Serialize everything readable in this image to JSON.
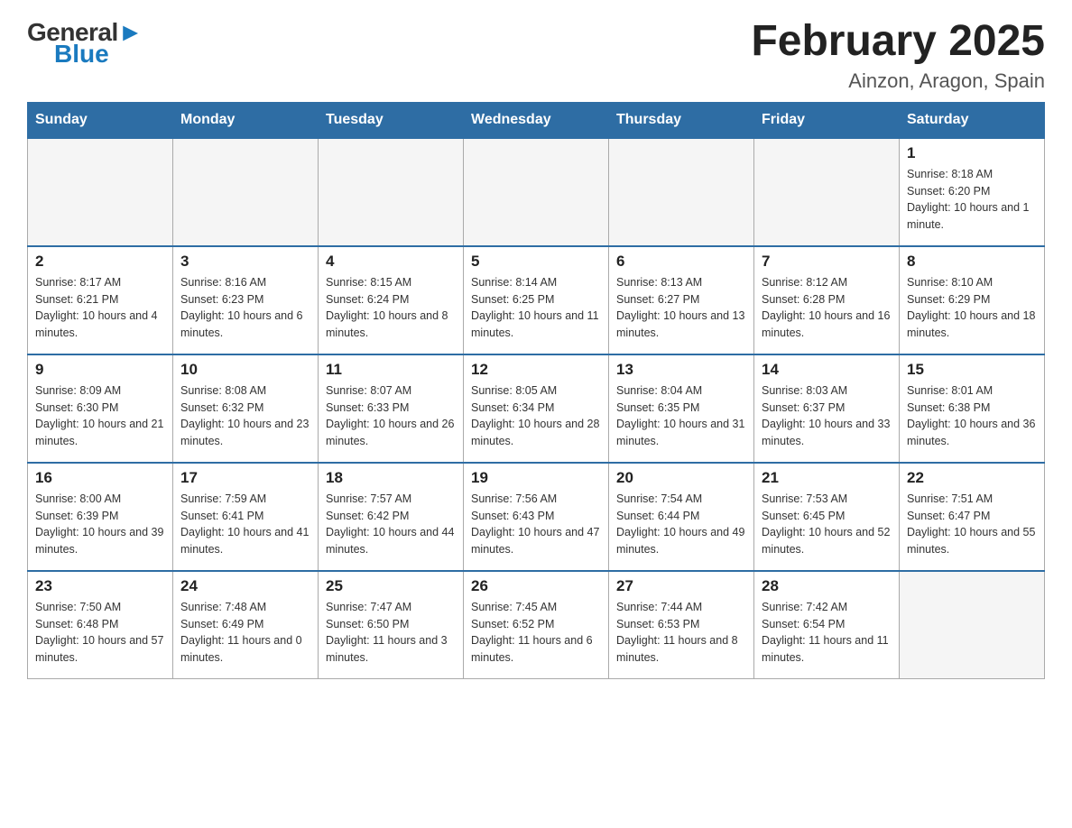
{
  "header": {
    "logo_general": "General",
    "logo_blue": "Blue",
    "title": "February 2025",
    "subtitle": "Ainzon, Aragon, Spain"
  },
  "days_of_week": [
    "Sunday",
    "Monday",
    "Tuesday",
    "Wednesday",
    "Thursday",
    "Friday",
    "Saturday"
  ],
  "weeks": [
    [
      {
        "day": "",
        "info": ""
      },
      {
        "day": "",
        "info": ""
      },
      {
        "day": "",
        "info": ""
      },
      {
        "day": "",
        "info": ""
      },
      {
        "day": "",
        "info": ""
      },
      {
        "day": "",
        "info": ""
      },
      {
        "day": "1",
        "info": "Sunrise: 8:18 AM\nSunset: 6:20 PM\nDaylight: 10 hours and 1 minute."
      }
    ],
    [
      {
        "day": "2",
        "info": "Sunrise: 8:17 AM\nSunset: 6:21 PM\nDaylight: 10 hours and 4 minutes."
      },
      {
        "day": "3",
        "info": "Sunrise: 8:16 AM\nSunset: 6:23 PM\nDaylight: 10 hours and 6 minutes."
      },
      {
        "day": "4",
        "info": "Sunrise: 8:15 AM\nSunset: 6:24 PM\nDaylight: 10 hours and 8 minutes."
      },
      {
        "day": "5",
        "info": "Sunrise: 8:14 AM\nSunset: 6:25 PM\nDaylight: 10 hours and 11 minutes."
      },
      {
        "day": "6",
        "info": "Sunrise: 8:13 AM\nSunset: 6:27 PM\nDaylight: 10 hours and 13 minutes."
      },
      {
        "day": "7",
        "info": "Sunrise: 8:12 AM\nSunset: 6:28 PM\nDaylight: 10 hours and 16 minutes."
      },
      {
        "day": "8",
        "info": "Sunrise: 8:10 AM\nSunset: 6:29 PM\nDaylight: 10 hours and 18 minutes."
      }
    ],
    [
      {
        "day": "9",
        "info": "Sunrise: 8:09 AM\nSunset: 6:30 PM\nDaylight: 10 hours and 21 minutes."
      },
      {
        "day": "10",
        "info": "Sunrise: 8:08 AM\nSunset: 6:32 PM\nDaylight: 10 hours and 23 minutes."
      },
      {
        "day": "11",
        "info": "Sunrise: 8:07 AM\nSunset: 6:33 PM\nDaylight: 10 hours and 26 minutes."
      },
      {
        "day": "12",
        "info": "Sunrise: 8:05 AM\nSunset: 6:34 PM\nDaylight: 10 hours and 28 minutes."
      },
      {
        "day": "13",
        "info": "Sunrise: 8:04 AM\nSunset: 6:35 PM\nDaylight: 10 hours and 31 minutes."
      },
      {
        "day": "14",
        "info": "Sunrise: 8:03 AM\nSunset: 6:37 PM\nDaylight: 10 hours and 33 minutes."
      },
      {
        "day": "15",
        "info": "Sunrise: 8:01 AM\nSunset: 6:38 PM\nDaylight: 10 hours and 36 minutes."
      }
    ],
    [
      {
        "day": "16",
        "info": "Sunrise: 8:00 AM\nSunset: 6:39 PM\nDaylight: 10 hours and 39 minutes."
      },
      {
        "day": "17",
        "info": "Sunrise: 7:59 AM\nSunset: 6:41 PM\nDaylight: 10 hours and 41 minutes."
      },
      {
        "day": "18",
        "info": "Sunrise: 7:57 AM\nSunset: 6:42 PM\nDaylight: 10 hours and 44 minutes."
      },
      {
        "day": "19",
        "info": "Sunrise: 7:56 AM\nSunset: 6:43 PM\nDaylight: 10 hours and 47 minutes."
      },
      {
        "day": "20",
        "info": "Sunrise: 7:54 AM\nSunset: 6:44 PM\nDaylight: 10 hours and 49 minutes."
      },
      {
        "day": "21",
        "info": "Sunrise: 7:53 AM\nSunset: 6:45 PM\nDaylight: 10 hours and 52 minutes."
      },
      {
        "day": "22",
        "info": "Sunrise: 7:51 AM\nSunset: 6:47 PM\nDaylight: 10 hours and 55 minutes."
      }
    ],
    [
      {
        "day": "23",
        "info": "Sunrise: 7:50 AM\nSunset: 6:48 PM\nDaylight: 10 hours and 57 minutes."
      },
      {
        "day": "24",
        "info": "Sunrise: 7:48 AM\nSunset: 6:49 PM\nDaylight: 11 hours and 0 minutes."
      },
      {
        "day": "25",
        "info": "Sunrise: 7:47 AM\nSunset: 6:50 PM\nDaylight: 11 hours and 3 minutes."
      },
      {
        "day": "26",
        "info": "Sunrise: 7:45 AM\nSunset: 6:52 PM\nDaylight: 11 hours and 6 minutes."
      },
      {
        "day": "27",
        "info": "Sunrise: 7:44 AM\nSunset: 6:53 PM\nDaylight: 11 hours and 8 minutes."
      },
      {
        "day": "28",
        "info": "Sunrise: 7:42 AM\nSunset: 6:54 PM\nDaylight: 11 hours and 11 minutes."
      },
      {
        "day": "",
        "info": ""
      }
    ]
  ]
}
